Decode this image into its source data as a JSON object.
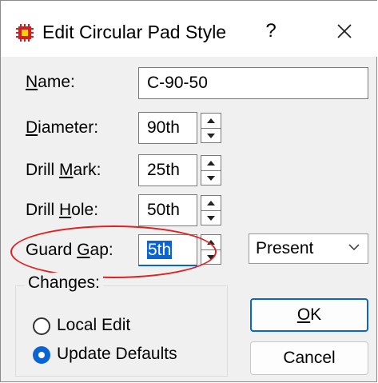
{
  "window": {
    "title": "Edit Circular Pad Style",
    "help_label": "?",
    "app_icon": "pad-icon",
    "close_icon": "close-icon"
  },
  "fields": [
    {
      "label_before": "",
      "label_underline": "N",
      "label_after": "ame:",
      "value": "C-90-50"
    },
    {
      "label_before": "",
      "label_underline": "D",
      "label_after": "iameter:",
      "value": "90th"
    },
    {
      "label_before": "Drill ",
      "label_underline": "M",
      "label_after": "ark:",
      "value": "25th"
    },
    {
      "label_before": "Drill ",
      "label_underline": "H",
      "label_after": "ole:",
      "value": "50th"
    },
    {
      "label_before": "Guard ",
      "label_underline": "G",
      "label_after": "ap:",
      "value": "5th"
    }
  ],
  "guard_gap_mode": {
    "selected": "Present"
  },
  "changes": {
    "title": "Changes:",
    "options": [
      {
        "label": "Local Edit",
        "checked": false
      },
      {
        "label": "Update Defaults",
        "checked": true
      }
    ]
  },
  "buttons": {
    "ok_underline": "O",
    "ok_rest": "K",
    "cancel": "Cancel"
  },
  "colors": {
    "accent": "#0a64d4",
    "highlight_circle": "#e32020",
    "dialog_bg": "#f0f0f0"
  }
}
